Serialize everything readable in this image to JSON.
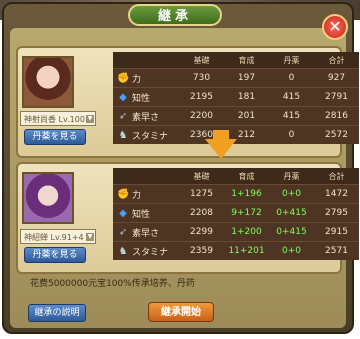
{
  "dialog": {
    "title": "継承",
    "close": "✕"
  },
  "top": {
    "name": "神射尚香 Lv.100",
    "button": "丹薬を見る",
    "headers": [
      "基礎",
      "育成",
      "丹薬",
      "合計"
    ],
    "rows": [
      {
        "icon": "power-icon",
        "glyph": "✊",
        "label": "力",
        "v": [
          "730",
          "197",
          "0",
          "927"
        ]
      },
      {
        "icon": "intel-icon",
        "glyph": "◆",
        "label": "知性",
        "v": [
          "2195",
          "181",
          "415",
          "2791"
        ]
      },
      {
        "icon": "speed-icon",
        "glyph": "➶",
        "label": "素早さ",
        "v": [
          "2200",
          "201",
          "415",
          "2816"
        ]
      },
      {
        "icon": "stamina-icon",
        "glyph": "♞",
        "label": "スタミナ",
        "v": [
          "2360",
          "212",
          "0",
          "2572"
        ]
      }
    ]
  },
  "bottom": {
    "name": "神紹蝉 Lv.91+4",
    "button": "丹薬を見る",
    "headers": [
      "基礎",
      "育成",
      "丹薬",
      "合計"
    ],
    "rows": [
      {
        "icon": "power-icon",
        "glyph": "✊",
        "label": "力",
        "v": [
          "1275",
          "1+196",
          "0+0",
          "1472"
        ]
      },
      {
        "icon": "intel-icon",
        "glyph": "◆",
        "label": "知性",
        "v": [
          "2208",
          "9+172",
          "0+415",
          "2795"
        ]
      },
      {
        "icon": "speed-icon",
        "glyph": "➶",
        "label": "素早さ",
        "v": [
          "2299",
          "1+200",
          "0+415",
          "2915"
        ]
      },
      {
        "icon": "stamina-icon",
        "glyph": "♞",
        "label": "スタミナ",
        "v": [
          "2359",
          "11+201",
          "0+0",
          "2571"
        ]
      }
    ]
  },
  "info": "花费5000000元宝100%传承培养、丹药",
  "buttons": {
    "explain": "継承の説明",
    "start": "継承開始"
  }
}
